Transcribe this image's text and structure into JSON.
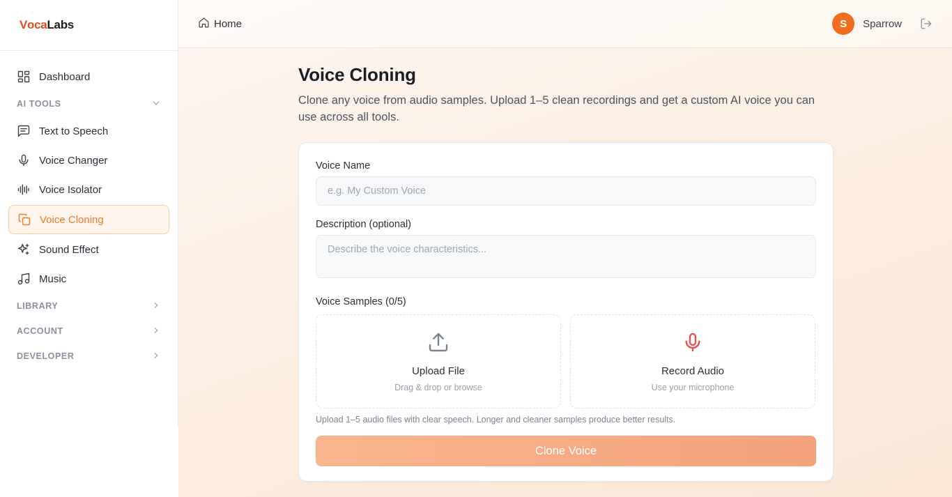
{
  "brand": {
    "logo_mark": "V",
    "logo_rest": "oca",
    "logo_labs": "Labs",
    "accent": "#ef7b2c"
  },
  "sidebar": {
    "dashboard": "Dashboard",
    "sections": {
      "ai_tools": "AI TOOLS",
      "library": "LIBRARY",
      "account": "ACCOUNT",
      "developer": "DEVELOPER"
    },
    "items": [
      {
        "label": "Text to Speech",
        "icon": "message-square-icon"
      },
      {
        "label": "Voice Changer",
        "icon": "microphone-icon"
      },
      {
        "label": "Voice Isolator",
        "icon": "waveform-icon"
      },
      {
        "label": "Voice Cloning",
        "icon": "copy-icon",
        "active": true
      },
      {
        "label": "Sound Effect",
        "icon": "sparkles-icon"
      },
      {
        "label": "Music",
        "icon": "music-note-icon"
      }
    ]
  },
  "header": {
    "breadcrumb": "Home",
    "user": {
      "initial": "S",
      "name": "Sparrow"
    }
  },
  "page": {
    "title": "Voice Cloning",
    "description": "Clone any voice from audio samples. Upload 1–5 clean recordings and get a custom AI voice you can use across all tools."
  },
  "form": {
    "voice_name_label": "Voice Name",
    "voice_name_placeholder": "e.g. My Custom Voice",
    "voice_name_value": "",
    "description_label": "Description (optional)",
    "description_placeholder": "Describe the voice characteristics...",
    "samples_label": "Voice Samples (0/5)",
    "upload": {
      "title": "Upload File",
      "subtitle": "Drag & drop or browse"
    },
    "record": {
      "title": "Record Audio",
      "subtitle": "Use your microphone"
    },
    "hint": "Upload 1–5 audio files with clear speech. Longer and cleaner samples produce better results.",
    "submit_label": "Clone Voice"
  }
}
